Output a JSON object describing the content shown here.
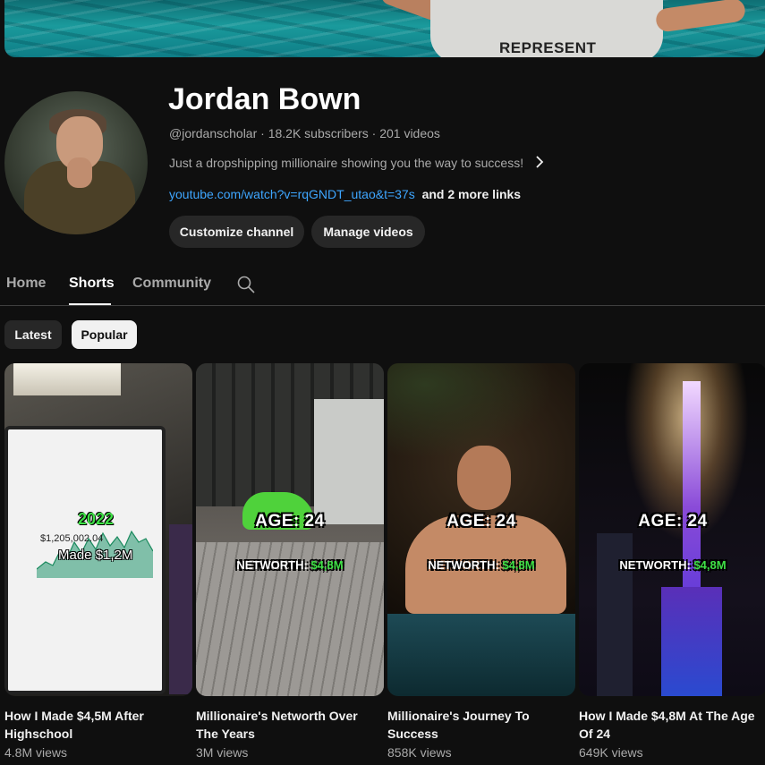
{
  "banner": {
    "shirt_text": "REPRESENT"
  },
  "channel": {
    "name": "Jordan Bown",
    "meta": "@jordanscholar · 18.2K subscribers · 201 videos",
    "description": "Just a dropshipping millionaire showing you the way to success!",
    "link_url": "youtube.com/watch?v=rqGNDT_utao&t=37s",
    "more_links": "and 2 more links"
  },
  "buttons": {
    "customize": "Customize channel",
    "manage": "Manage videos"
  },
  "tabs": [
    {
      "label": "Home",
      "active": false
    },
    {
      "label": "Shorts",
      "active": true
    },
    {
      "label": "Community",
      "active": false
    }
  ],
  "chips": [
    {
      "label": "Latest",
      "selected": false
    },
    {
      "label": "Popular",
      "selected": true
    }
  ],
  "shorts": [
    {
      "title": "How I Made $4,5M After Highschool",
      "views": "4.8M views",
      "overlay_year": "2022",
      "overlay_made": "Made $1,2M",
      "overlay_total": "$1,205,002.04"
    },
    {
      "title": "Millionaire's Networth Over The Years",
      "views": "3M views",
      "overlay_age": "AGE: 24",
      "overlay_networth_label": "NETWORTH:",
      "overlay_networth_value": "$4,8M"
    },
    {
      "title": "Millionaire's Journey To Success",
      "views": "858K views",
      "overlay_age": "AGE: 24",
      "overlay_networth_label": "NETWORTH:",
      "overlay_networth_value": "$4,8M"
    },
    {
      "title": "How I Made $4,8M At The Age Of 24",
      "views": "649K views",
      "overlay_age": "AGE: 24",
      "overlay_networth_label": "NETWORTH:",
      "overlay_networth_value": "$4,8M"
    }
  ],
  "colors": {
    "accent_link": "#3ea6ff",
    "networth_green": "#3fe046",
    "background": "#0f0f0f"
  }
}
